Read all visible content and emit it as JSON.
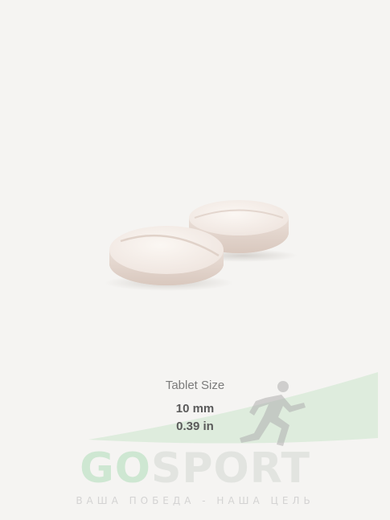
{
  "product_image": {
    "subject": "two tablets",
    "colors": {
      "background": "#f5f4f2",
      "tablet_face": "#f7f1ec",
      "tablet_edge": "#e6d8d0"
    }
  },
  "tablet_size": {
    "title": "Tablet Size",
    "mm": "10 mm",
    "inches": "0.39 in"
  },
  "watermark": {
    "brand_go": "GO",
    "brand_rest": "SPORT",
    "tagline": "ВАША ПОБЕДА - НАША ЦЕЛЬ",
    "icon": "runner-icon",
    "colors": {
      "green": "#9fd6a8",
      "gray": "#d2d7d2"
    }
  }
}
